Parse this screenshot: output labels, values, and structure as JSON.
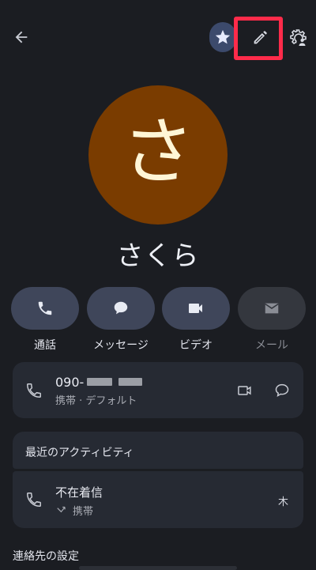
{
  "header": {
    "back_icon": "arrow-left-icon",
    "favorite_icon": "star-icon",
    "edit_icon": "pencil-icon",
    "settings_icon": "contact-settings-icon"
  },
  "contact": {
    "initial": "さ",
    "name": "さくら",
    "avatar_color": "#7a3c00"
  },
  "actions": [
    {
      "label": "通話",
      "icon": "phone-icon"
    },
    {
      "label": "メッセージ",
      "icon": "chat-icon"
    },
    {
      "label": "ビデオ",
      "icon": "video-icon"
    },
    {
      "label": "メール",
      "icon": "mail-icon"
    }
  ],
  "phone": {
    "number_prefix": "090-",
    "type": "携帯 · デフォルト"
  },
  "activity": {
    "title": "最近のアクティビティ",
    "item": {
      "title": "不在着信",
      "subtitle": "携帯",
      "day": "木"
    }
  },
  "settings_section": {
    "title": "連絡先の設定"
  },
  "colors": {
    "background": "#1b1d22",
    "accent_pill": "#3c4a6c",
    "highlight": "#ff2b4a"
  }
}
